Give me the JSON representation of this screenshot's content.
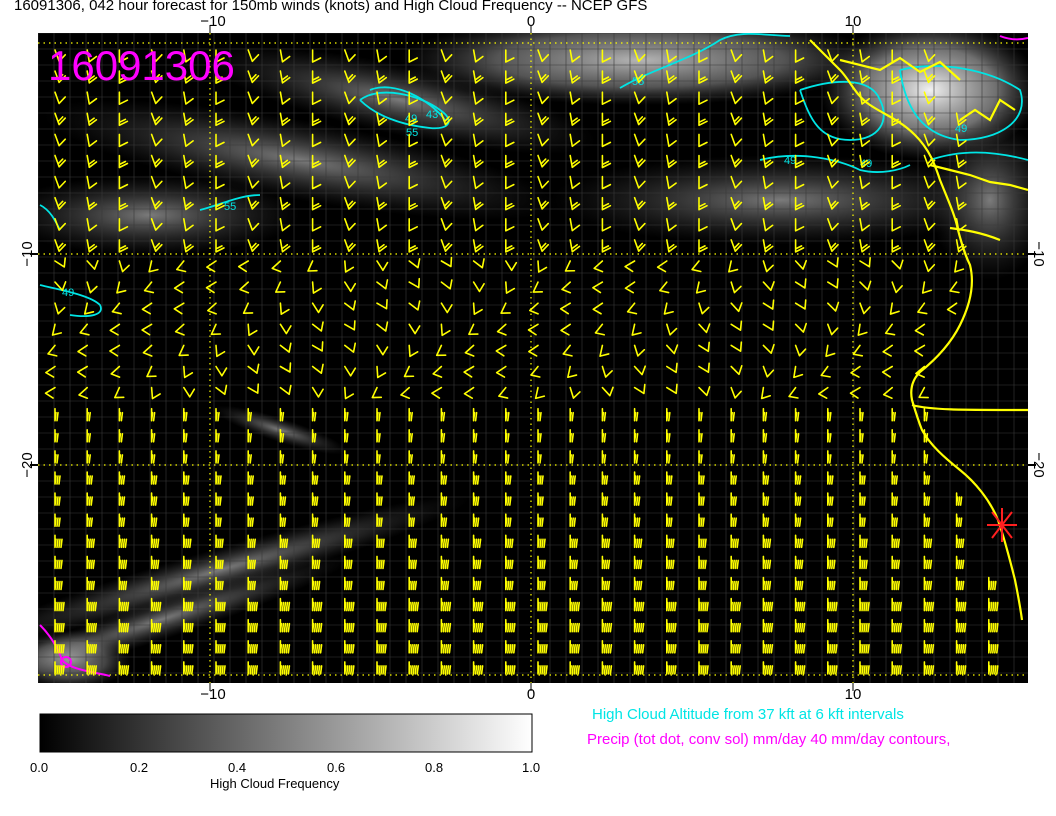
{
  "title": "16091306, 042 hour forecast for 150mb winds (knots) and High Cloud Frequency -- NCEP GFS",
  "stamp": "16091306",
  "x_ticks_top": [
    "−10",
    "0",
    "10"
  ],
  "x_ticks_bottom": [
    "−10",
    "0",
    "10"
  ],
  "y_ticks": [
    "−10",
    "−20"
  ],
  "contour_labels": [
    "55",
    "49",
    "43",
    "55",
    "49",
    "55",
    "49",
    "49",
    "49"
  ],
  "legend_cyan": "High Cloud Altitude from 37 kft at 6 kft intervals",
  "legend_magenta": "Precip (tot dot, conv sol) mm/day 40 mm/day contours,",
  "colorbar": {
    "title": "High Cloud Frequency",
    "ticks": [
      "0.0",
      "0.2",
      "0.4",
      "0.6",
      "0.8",
      "1.0"
    ]
  },
  "colors": {
    "barb": "#ffff00",
    "coast": "#ffff00",
    "contour": "#00e5e5",
    "precip": "#ff00ff",
    "marker": "#ff2020",
    "background": "#000000"
  }
}
